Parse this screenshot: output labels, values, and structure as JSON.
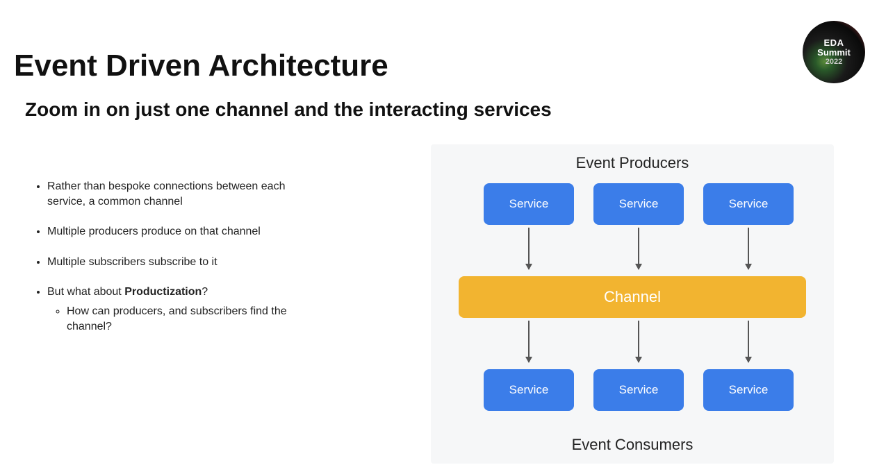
{
  "logo": {
    "line1": "EDA",
    "line2": "Summit",
    "line3": "2022"
  },
  "title": "Event Driven Architecture",
  "subtitle": "Zoom in on just one channel and the interacting services",
  "bullets": [
    {
      "text": "Rather than bespoke connections between each service, a common channel"
    },
    {
      "text": "Multiple producers produce on that channel"
    },
    {
      "text": "Multiple subscribers subscribe to it"
    },
    {
      "prefix": "But what about ",
      "bold": "Productization",
      "suffix": "?",
      "sub": [
        "How can producers, and subscribers find the channel?"
      ]
    }
  ],
  "diagram": {
    "top_label": "Event Producers",
    "bottom_label": "Event Consumers",
    "producers": [
      "Service",
      "Service",
      "Service"
    ],
    "consumers": [
      "Service",
      "Service",
      "Service"
    ],
    "channel": "Channel"
  }
}
